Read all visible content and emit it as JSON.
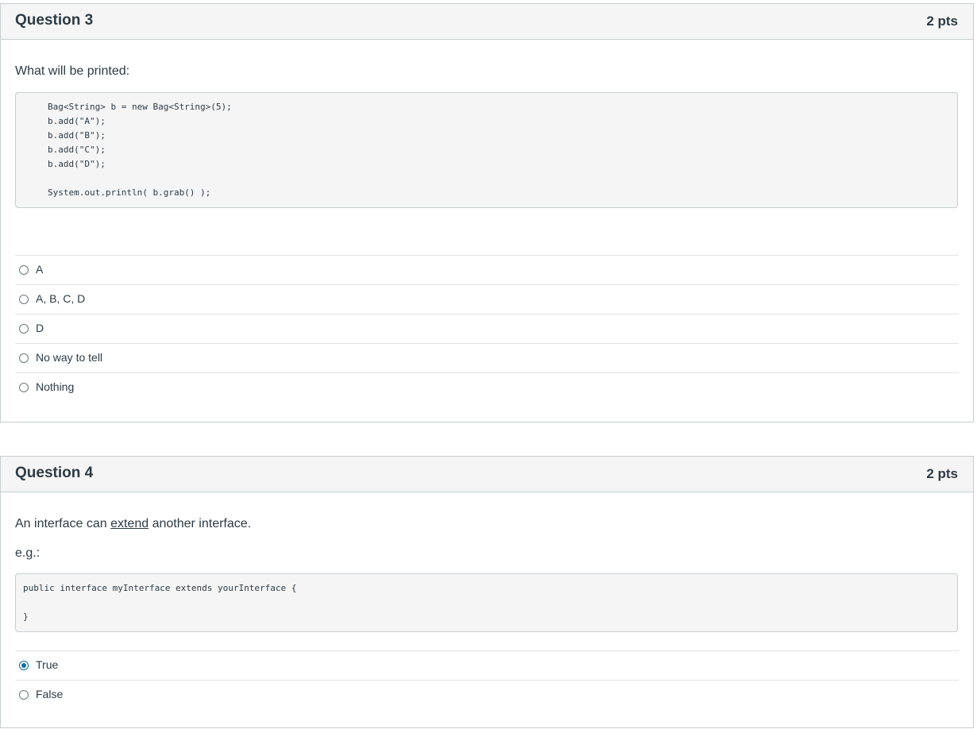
{
  "questions": [
    {
      "title": "Question 3",
      "points": "2 pts",
      "prompt": "What will be printed:",
      "code": [
        "Bag<String> b = new Bag<String>(5);",
        "b.add(\"A\");",
        "b.add(\"B\");",
        "b.add(\"C\");",
        "b.add(\"D\");",
        "",
        "System.out.println( b.grab() );"
      ],
      "answers": [
        {
          "label": "A",
          "selected": false
        },
        {
          "label": "A, B, C, D",
          "selected": false
        },
        {
          "label": "D",
          "selected": false
        },
        {
          "label": "No way to tell",
          "selected": false
        },
        {
          "label": "Nothing",
          "selected": false
        }
      ]
    },
    {
      "title": "Question 4",
      "points": "2 pts",
      "prompt_pre": "An interface can",
      "prompt_link": "extend",
      "prompt_post": "another interface.",
      "example_label": "e.g.:",
      "code": [
        "public interface myInterface extends yourInterface {",
        "",
        "}"
      ],
      "answers": [
        {
          "label": "True",
          "selected": true
        },
        {
          "label": "False",
          "selected": false
        }
      ]
    }
  ],
  "colors": {
    "header_bg": "#f5f5f5",
    "border": "#c7cdd1",
    "text": "#2d3b45",
    "radio_selected": "#0770a3"
  }
}
